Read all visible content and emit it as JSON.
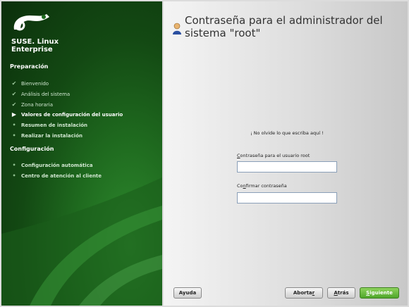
{
  "brand": {
    "line1": "SUSE. Linux",
    "line2": "Enterprise"
  },
  "sidebar": {
    "section1_title": "Preparación",
    "steps": [
      {
        "label": "Bienvenido",
        "state": "done"
      },
      {
        "label": "Análisis del sistema",
        "state": "done"
      },
      {
        "label": "Zona horaria",
        "state": "done"
      },
      {
        "label": "Valores de configuración del usuario",
        "state": "current"
      },
      {
        "label": "Resumen de instalación",
        "state": "pending"
      },
      {
        "label": "Realizar la instalación",
        "state": "pending"
      }
    ],
    "section2_title": "Configuración",
    "steps2": [
      {
        "label": "Configuración automática",
        "state": "pending"
      },
      {
        "label": "Centro de atención al cliente",
        "state": "pending"
      }
    ]
  },
  "main": {
    "title": "Contraseña para el administrador del sistema \"root\"",
    "notice": "¡ No olvide lo que escriba aquí !",
    "password_label_first": "C",
    "password_label_rest": "ontraseña para el usuario root",
    "password_value": "",
    "confirm_label_pre": "Co",
    "confirm_label_key": "n",
    "confirm_label_rest": "firmar contraseña",
    "confirm_value": ""
  },
  "buttons": {
    "help": "Ayuda",
    "abort_pre": "Aborta",
    "abort_key": "r",
    "back_key": "A",
    "back_rest": "trás",
    "next_key": "S",
    "next_rest": "iguiente"
  },
  "colors": {
    "sidebar_green": "#1f6b1f",
    "primary_button": "#4fa62a"
  }
}
